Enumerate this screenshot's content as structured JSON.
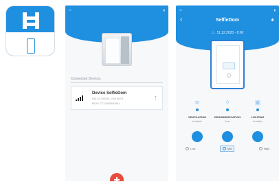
{
  "screen1": {
    "section_label": "Connected Devices",
    "device": {
      "name": "Device SelfieDom",
      "sub1": "SN: 01-F0040 1234 5678",
      "sub2": "MOD: TC-0000000001"
    }
  },
  "screen2": {
    "title": "SelfieDom",
    "date": "11.12.2020 - 8:00",
    "modes": [
      {
        "label": "VENTILATION",
        "status": "Available",
        "icon": "fan-icon"
      },
      {
        "label": "DEHUMIDIFICATION",
        "status": "Auto",
        "icon": "drop-icon"
      },
      {
        "label": "LIGHTING",
        "status": "Available",
        "icon": "lamp-icon"
      }
    ],
    "options": [
      {
        "label": "Low"
      },
      {
        "label": "Mid"
      },
      {
        "label": "High"
      }
    ]
  },
  "colors": {
    "accent": "#1f8fe0",
    "fab": "#e74c3c"
  }
}
